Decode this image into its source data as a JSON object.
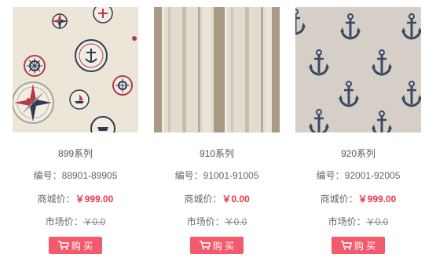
{
  "products": [
    {
      "series": "899系列",
      "code_label": "编号：",
      "code": "88901-89905",
      "mall_label": "商城价：",
      "mall_price": "￥999.00",
      "market_label": "市场价：",
      "market_price": "￥0.0",
      "buy_label": "购 买",
      "pattern_icon": "compass-rose-pattern",
      "colors": {
        "bg": "#ece6d8"
      }
    },
    {
      "series": "910系列",
      "code_label": "编号：",
      "code": "91001-91005",
      "mall_label": "商城价：",
      "mall_price": "￥0.00",
      "market_label": "市场价：",
      "market_price": "￥0.0",
      "buy_label": "购 买",
      "pattern_icon": "stripe-pattern",
      "colors": {
        "bg": "#e2dbcf"
      }
    },
    {
      "series": "920系列",
      "code_label": "编号：",
      "code": "92001-92005",
      "mall_label": "商城价：",
      "mall_price": "￥999.00",
      "market_label": "市场价：",
      "market_price": "￥0.0",
      "buy_label": "购 买",
      "pattern_icon": "anchor-pattern",
      "colors": {
        "bg": "#d9d3cb"
      }
    }
  ],
  "theme": {
    "accent": "#f25b6c",
    "price_red": "#e8394b"
  }
}
